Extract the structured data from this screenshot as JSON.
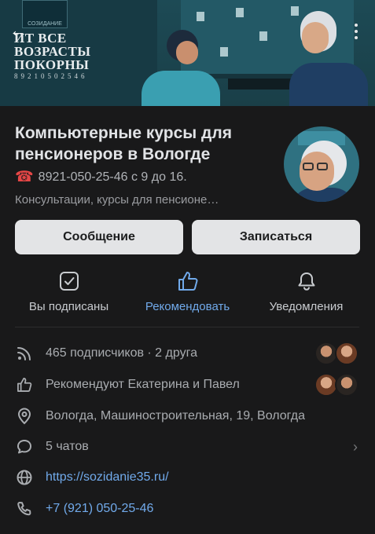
{
  "cover": {
    "logo_text": "СОЗИДАНИЕ",
    "headline": "ИТ ВСЕ ВОЗРАСТЫ ПОКОРНЫ",
    "phone": "89210502546"
  },
  "group": {
    "title": "Компьютерные курсы для пенсионеров в Вологде",
    "status_phone": "8921-050-25-46 с 9 до 16.",
    "description": "Консультации, курсы для пенсионе…"
  },
  "buttons": {
    "message": "Сообщение",
    "join": "Записаться"
  },
  "actions": [
    {
      "label": "Вы подписаны",
      "icon": "check-square-icon"
    },
    {
      "label": "Рекомендовать",
      "icon": "thumbs-up-icon"
    },
    {
      "label": "Уведомления",
      "icon": "bell-icon"
    }
  ],
  "info": {
    "subscribers": "465 подписчиков · 2 друга",
    "recommend": "Рекомендуют Екатерина и Павел",
    "address": "Вологда, Машиностроительная, 19, Вологда",
    "chats": "5 чатов",
    "website": "https://sozidanie35.ru/",
    "phone": "+7 (921) 050-25-46"
  },
  "colors": {
    "background": "#19191a",
    "accent": "#71aaeb",
    "button_bg": "#e3e4e6",
    "phone_icon": "#e64646"
  }
}
